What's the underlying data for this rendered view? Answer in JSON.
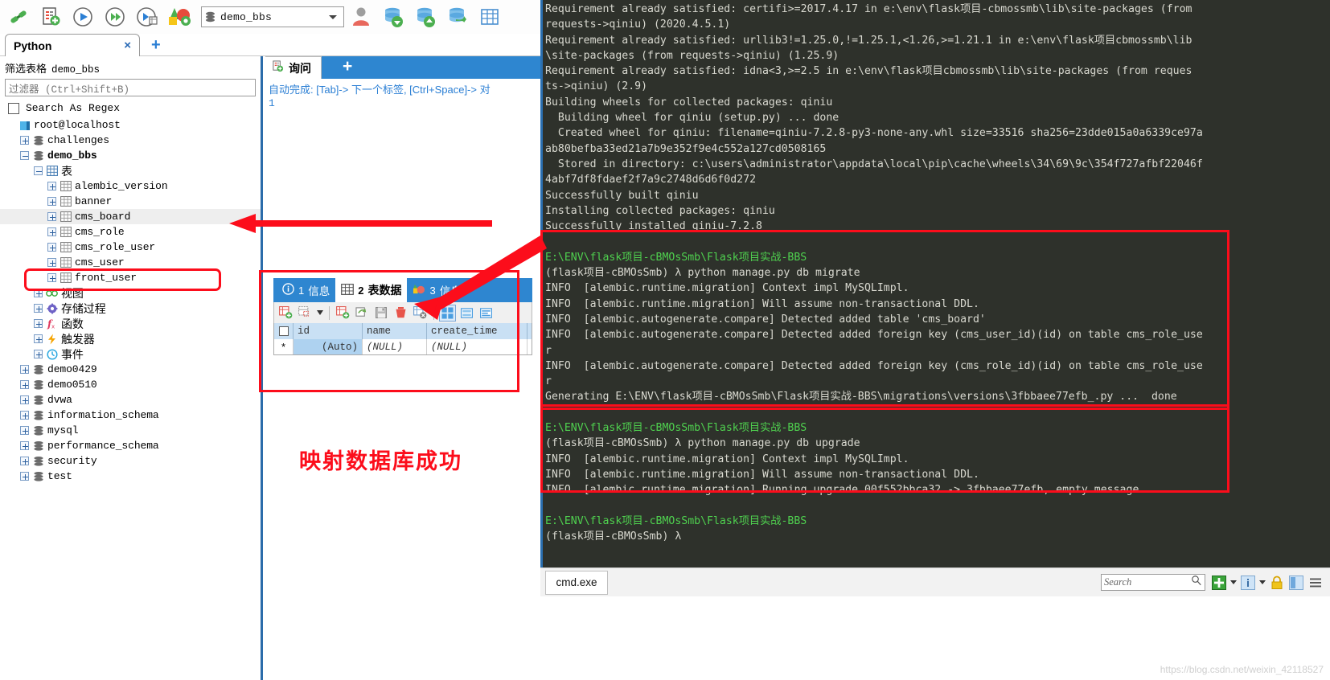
{
  "app": {
    "name": "Navicat",
    "database_combo": {
      "value": "demo_bbs",
      "icon": "database-icon"
    },
    "toolbar_buttons": [
      {
        "name": "connection-icon",
        "label": "连接"
      },
      {
        "name": "new-query-icon",
        "label": "新建查询"
      },
      {
        "name": "run-icon",
        "label": "运行"
      },
      {
        "name": "run-all-icon",
        "label": "运行全部"
      },
      {
        "name": "explain-icon",
        "label": "解释"
      },
      {
        "name": "model-icon",
        "label": "模型"
      },
      {
        "name": "user-icon",
        "label": "用户"
      },
      {
        "name": "import-icon",
        "label": "导入"
      },
      {
        "name": "export-icon",
        "label": "导出"
      },
      {
        "name": "transfer-icon",
        "label": "数据传输"
      },
      {
        "name": "grid-icon",
        "label": "表格"
      }
    ],
    "connection_tab": {
      "label": "Python",
      "close": "×",
      "add": "+"
    }
  },
  "tree_panel": {
    "filter_label": "筛选表格",
    "filter_db": "demo_bbs",
    "filter_placeholder": "过滤器 (Ctrl+Shift+B)",
    "search_as_regex": "Search As Regex",
    "root": "root@localhost",
    "nodes": [
      {
        "label": "challenges",
        "icon": "database-icon",
        "indent": 1,
        "expander": "plus",
        "bold": false,
        "cjk": false
      },
      {
        "label": "demo_bbs",
        "icon": "database-icon",
        "indent": 1,
        "expander": "minus",
        "bold": true,
        "cjk": false
      },
      {
        "label": "表",
        "icon": "table-group-icon",
        "indent": 2,
        "expander": "minus",
        "bold": false,
        "cjk": true
      },
      {
        "label": "alembic_version",
        "icon": "table-icon",
        "indent": 3,
        "expander": "plus",
        "bold": false,
        "cjk": false
      },
      {
        "label": "banner",
        "icon": "table-icon",
        "indent": 3,
        "expander": "plus",
        "bold": false,
        "cjk": false
      },
      {
        "label": "cms_board",
        "icon": "table-icon",
        "indent": 3,
        "expander": "plus",
        "bold": false,
        "cjk": false,
        "highlight": true
      },
      {
        "label": "cms_role",
        "icon": "table-icon",
        "indent": 3,
        "expander": "plus",
        "bold": false,
        "cjk": false
      },
      {
        "label": "cms_role_user",
        "icon": "table-icon",
        "indent": 3,
        "expander": "plus",
        "bold": false,
        "cjk": false
      },
      {
        "label": "cms_user",
        "icon": "table-icon",
        "indent": 3,
        "expander": "plus",
        "bold": false,
        "cjk": false
      },
      {
        "label": "front_user",
        "icon": "table-icon",
        "indent": 3,
        "expander": "plus",
        "bold": false,
        "cjk": false
      },
      {
        "label": "视图",
        "icon": "view-icon",
        "indent": 2,
        "expander": "plus",
        "bold": false,
        "cjk": true
      },
      {
        "label": "存储过程",
        "icon": "procedure-icon",
        "indent": 2,
        "expander": "plus",
        "bold": false,
        "cjk": true
      },
      {
        "label": "函数",
        "icon": "function-icon",
        "indent": 2,
        "expander": "plus",
        "bold": false,
        "cjk": true
      },
      {
        "label": "触发器",
        "icon": "trigger-icon",
        "indent": 2,
        "expander": "plus",
        "bold": false,
        "cjk": true
      },
      {
        "label": "事件",
        "icon": "event-icon",
        "indent": 2,
        "expander": "plus",
        "bold": false,
        "cjk": true
      },
      {
        "label": "demo0429",
        "icon": "database-icon",
        "indent": 1,
        "expander": "plus",
        "bold": false,
        "cjk": false
      },
      {
        "label": "demo0510",
        "icon": "database-icon",
        "indent": 1,
        "expander": "plus",
        "bold": false,
        "cjk": false
      },
      {
        "label": "dvwa",
        "icon": "database-icon",
        "indent": 1,
        "expander": "plus",
        "bold": false,
        "cjk": false
      },
      {
        "label": "information_schema",
        "icon": "database-icon",
        "indent": 1,
        "expander": "plus",
        "bold": false,
        "cjk": false
      },
      {
        "label": "mysql",
        "icon": "database-icon",
        "indent": 1,
        "expander": "plus",
        "bold": false,
        "cjk": false
      },
      {
        "label": "performance_schema",
        "icon": "database-icon",
        "indent": 1,
        "expander": "plus",
        "bold": false,
        "cjk": false
      },
      {
        "label": "security",
        "icon": "database-icon",
        "indent": 1,
        "expander": "plus",
        "bold": false,
        "cjk": false
      },
      {
        "label": "test",
        "icon": "database-icon",
        "indent": 1,
        "expander": "plus",
        "bold": false,
        "cjk": false
      }
    ]
  },
  "query_panel": {
    "tab_label": "询问",
    "tab_add": "+",
    "autocomplete_hint": "自动完成: [Tab]-> 下一个标签, [Ctrl+Space]-> 对",
    "line_number": "1",
    "result_tabs": [
      {
        "num": "1",
        "label": "信息",
        "icon": "info-icon",
        "active": false
      },
      {
        "num": "2",
        "label": "表数据",
        "icon": "table-icon",
        "active": true
      },
      {
        "num": "3",
        "label": "信息",
        "icon": "profile-icon",
        "active": false
      }
    ],
    "grid_toolbar": [
      "add-record-icon",
      "copy-record-icon",
      "insert-record-icon",
      "apply-icon",
      "save-icon",
      "delete-record-icon",
      "cancel-icon",
      "grid-view-icon",
      "form-view-icon",
      "detail-view-icon"
    ],
    "grid": {
      "columns": [
        "id",
        "name",
        "create_time"
      ],
      "rows": [
        {
          "marker": "*",
          "cells": [
            "(Auto)",
            "(NULL)",
            "(NULL)"
          ]
        }
      ]
    }
  },
  "annotation": {
    "text": "映射数据库成功"
  },
  "console": {
    "lines": [
      {
        "t": "Requirement already satisfied: certifi>=2017.4.17 in e:\\env\\flask项目-cbmossmb\\lib\\site-packages (from",
        "c": "n"
      },
      {
        "t": "requests->qiniu) (2020.4.5.1)",
        "c": "n"
      },
      {
        "t": "Requirement already satisfied: urllib3!=1.25.0,!=1.25.1,<1.26,>=1.21.1 in e:\\env\\flask项目cbmossmb\\lib",
        "c": "n"
      },
      {
        "t": "\\site-packages (from requests->qiniu) (1.25.9)",
        "c": "n"
      },
      {
        "t": "Requirement already satisfied: idna<3,>=2.5 in e:\\env\\flask项目cbmossmb\\lib\\site-packages (from reques",
        "c": "n"
      },
      {
        "t": "ts->qiniu) (2.9)",
        "c": "n"
      },
      {
        "t": "Building wheels for collected packages: qiniu",
        "c": "n"
      },
      {
        "t": "  Building wheel for qiniu (setup.py) ... done",
        "c": "n"
      },
      {
        "t": "  Created wheel for qiniu: filename=qiniu-7.2.8-py3-none-any.whl size=33516 sha256=23dde015a0a6339ce97a",
        "c": "n"
      },
      {
        "t": "ab80befba33ed21a7b9e352f9e4c552a127cd0508165",
        "c": "n"
      },
      {
        "t": "  Stored in directory: c:\\users\\administrator\\appdata\\local\\pip\\cache\\wheels\\34\\69\\9c\\354f727afbf22046f",
        "c": "n"
      },
      {
        "t": "4abf7df8fdaef2f7a9c2748d6d6f0d272",
        "c": "n"
      },
      {
        "t": "Successfully built qiniu",
        "c": "n"
      },
      {
        "t": "Installing collected packages: qiniu",
        "c": "n"
      },
      {
        "t": "Successfully installed qiniu-7.2.8",
        "c": "n"
      },
      {
        "t": "",
        "c": "n"
      },
      {
        "t": "E:\\ENV\\flask项目-cBMOsSmb\\Flask项目实战-BBS",
        "c": "g"
      },
      {
        "t": "(flask项目-cBMOsSmb) λ python manage.py db migrate",
        "c": "n"
      },
      {
        "t": "INFO  [alembic.runtime.migration] Context impl MySQLImpl.",
        "c": "n"
      },
      {
        "t": "INFO  [alembic.runtime.migration] Will assume non-transactional DDL.",
        "c": "n"
      },
      {
        "t": "INFO  [alembic.autogenerate.compare] Detected added table 'cms_board'",
        "c": "n"
      },
      {
        "t": "INFO  [alembic.autogenerate.compare] Detected added foreign key (cms_user_id)(id) on table cms_role_use",
        "c": "n"
      },
      {
        "t": "r",
        "c": "n"
      },
      {
        "t": "INFO  [alembic.autogenerate.compare] Detected added foreign key (cms_role_id)(id) on table cms_role_use",
        "c": "n"
      },
      {
        "t": "r",
        "c": "n"
      },
      {
        "t": "Generating E:\\ENV\\flask项目-cBMOsSmb\\Flask项目实战-BBS\\migrations\\versions\\3fbbaee77efb_.py ...  done",
        "c": "n"
      },
      {
        "t": "",
        "c": "n"
      },
      {
        "t": "E:\\ENV\\flask项目-cBMOsSmb\\Flask项目实战-BBS",
        "c": "g"
      },
      {
        "t": "(flask项目-cBMOsSmb) λ python manage.py db upgrade",
        "c": "n"
      },
      {
        "t": "INFO  [alembic.runtime.migration] Context impl MySQLImpl.",
        "c": "n"
      },
      {
        "t": "INFO  [alembic.runtime.migration] Will assume non-transactional DDL.",
        "c": "n"
      },
      {
        "t": "INFO  [alembic.runtime.migration] Running upgrade 00f552bbca32 -> 3fbbaee77efb, empty message",
        "c": "n"
      },
      {
        "t": "",
        "c": "n"
      },
      {
        "t": "E:\\ENV\\flask项目-cBMOsSmb\\Flask项目实战-BBS",
        "c": "g"
      },
      {
        "t": "(flask项目-cBMOsSmb) λ",
        "c": "n"
      }
    ],
    "statusbar": {
      "tab_label": "cmd.exe",
      "search_placeholder": "Search",
      "icons": [
        "search-icon",
        "new-tab-icon",
        "dropdown-arrow-icon",
        "info-icon",
        "dropdown-arrow-icon-2",
        "lock-icon",
        "panel-icon",
        "menu-icon"
      ]
    }
  },
  "watermark": "https://blog.csdn.net/weixin_42118527"
}
